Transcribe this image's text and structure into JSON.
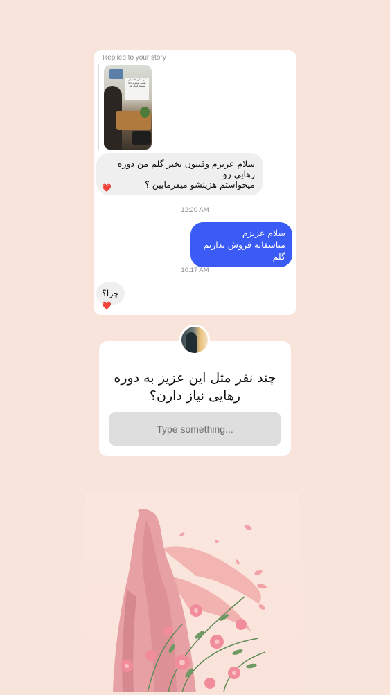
{
  "chat": {
    "replied_label": "Replied to your story",
    "story_note": "من سال ها دنبال رهایی بودم و حالا میتونم کمک کنم",
    "messages": [
      {
        "from": "them",
        "line1": "سلام عزیزم وقتتون بخیر گلم من دوره رهایی رو",
        "line2": "میخواستم هزینشو میفرمایین ؟",
        "reaction": "❤️"
      },
      {
        "from": "me",
        "line1": "سلام عزیزم",
        "line2": "متاسفانه فروش نداریم گلم"
      },
      {
        "from": "them",
        "line1": "چرا؟",
        "reaction": "❤️"
      }
    ],
    "timestamps": [
      "12:20 AM",
      "10:17 AM"
    ]
  },
  "question_sticker": {
    "question": "چند نفر مثل این عزیز به دوره رهایی نیاز دارن؟",
    "placeholder": "Type something..."
  },
  "colors": {
    "background": "#f9e4db",
    "outgoing_bubble": "#3b5bf6",
    "incoming_bubble": "#efefef"
  }
}
